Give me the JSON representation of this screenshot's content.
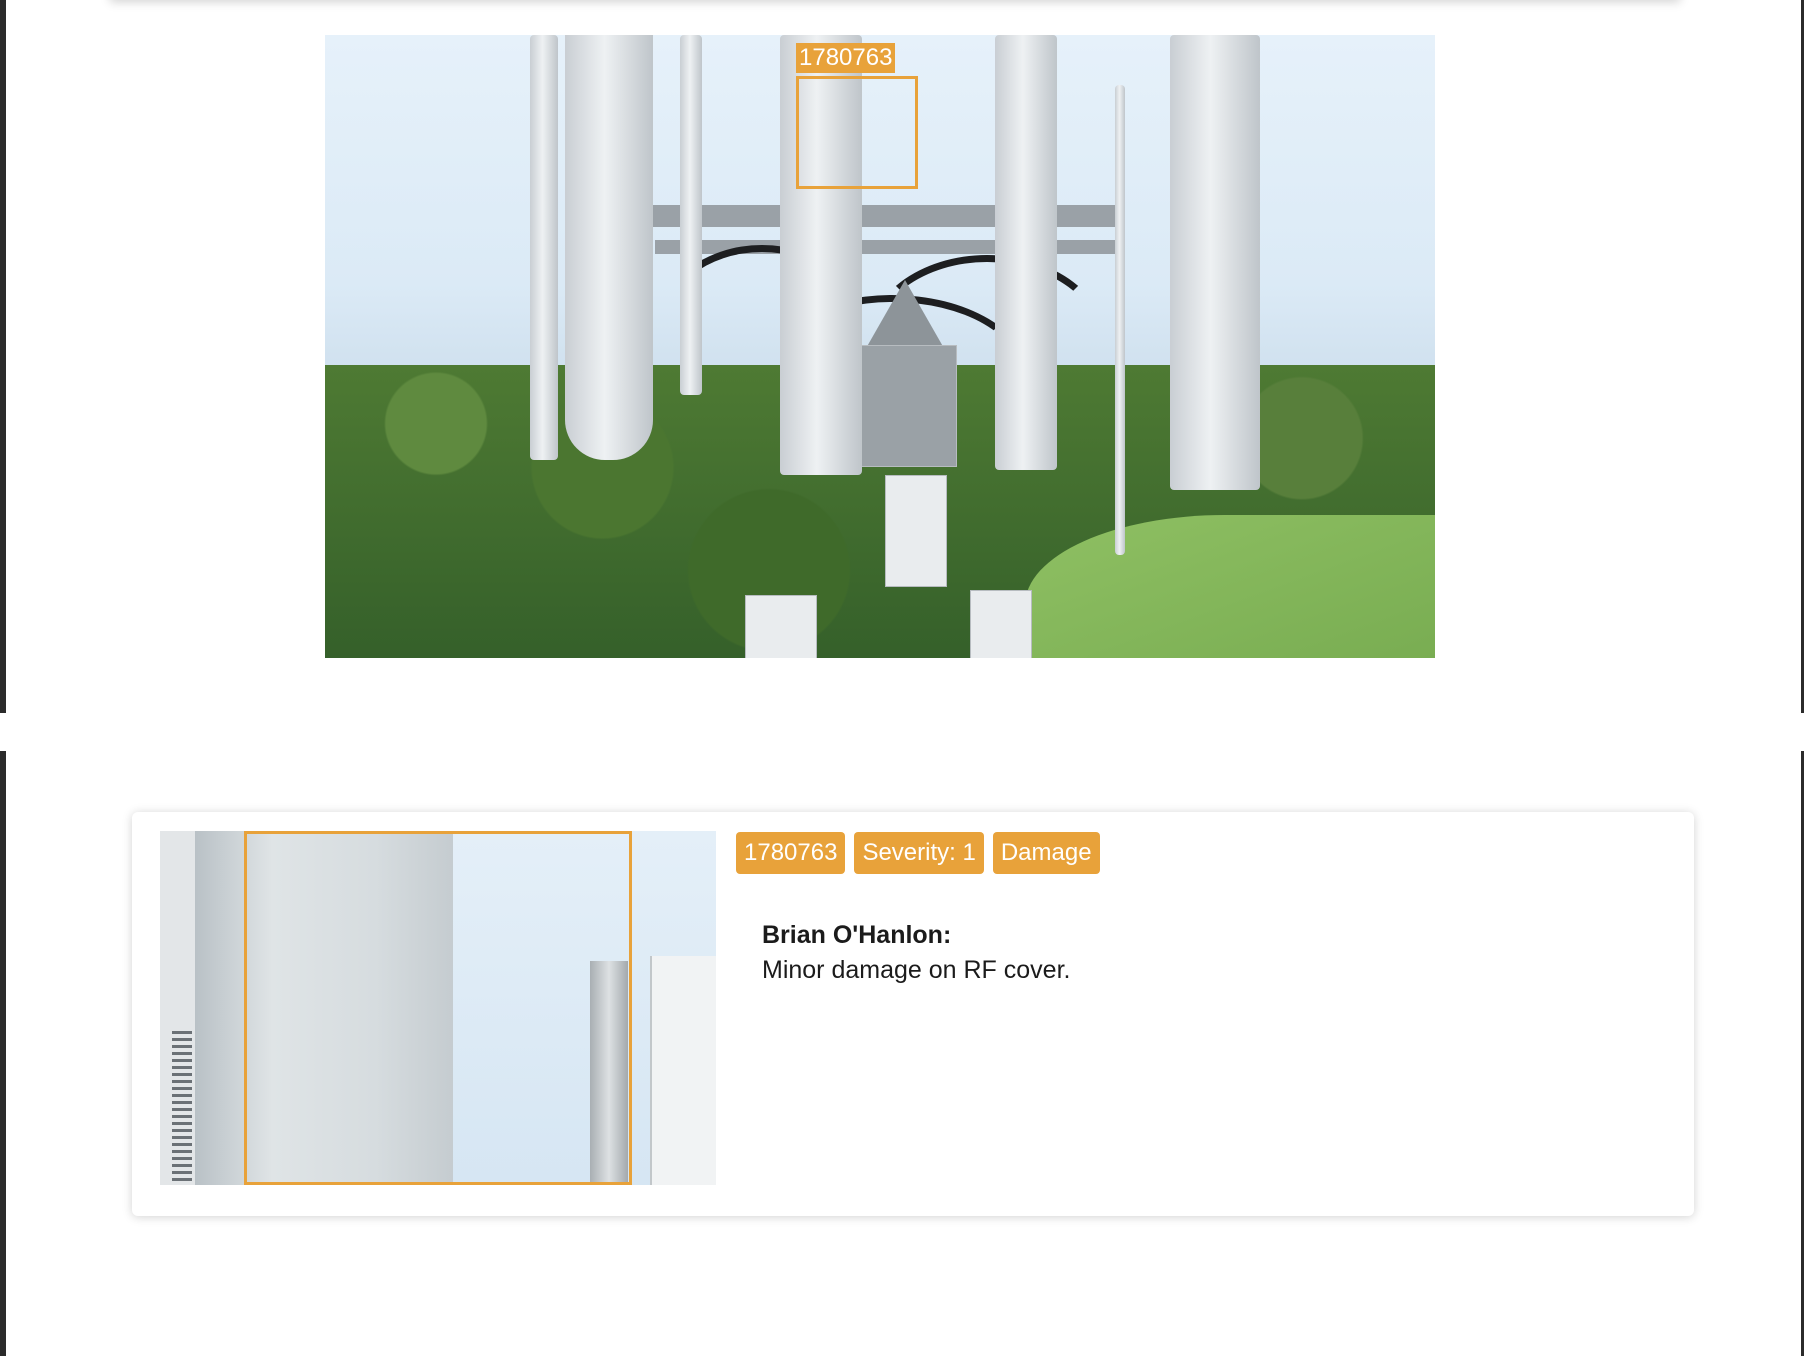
{
  "annotation": {
    "id_label": "1780763"
  },
  "finding": {
    "badges": {
      "id": "1780763",
      "severity": "Severity: 1",
      "category": "Damage"
    },
    "comment": {
      "author": "Brian O'Hanlon:",
      "text": "Minor damage on RF cover."
    }
  },
  "colors": {
    "accent": "#e8a23a",
    "page_edge": "#2b2b2b"
  }
}
